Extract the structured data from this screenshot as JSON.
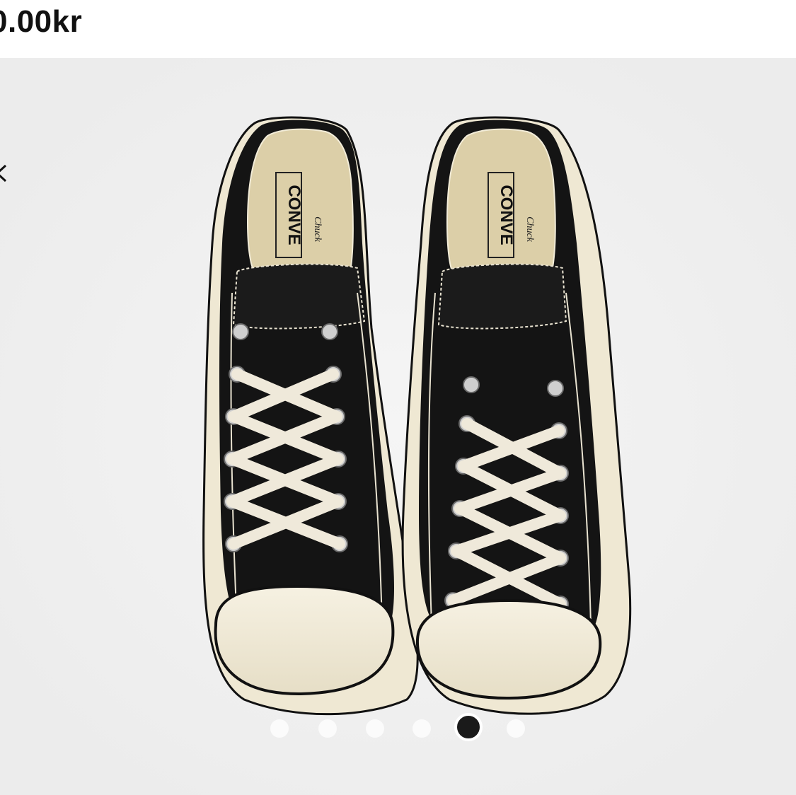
{
  "product": {
    "price_text": "0.00kr"
  },
  "gallery": {
    "image_name": "converse-chuck-70-low-black-pair",
    "brand_print": "CONVERSE",
    "script_print": "Chuck",
    "slide_count": 6,
    "active_slide": 5,
    "background_color": "#f1f1f1"
  },
  "colors": {
    "canvas_black": "#111111",
    "rubber_cream": "#f2ecd8",
    "lace_cream": "#efe9da",
    "insole": "#dccfa8"
  },
  "icons": {
    "prev": "chevron-left-icon"
  }
}
